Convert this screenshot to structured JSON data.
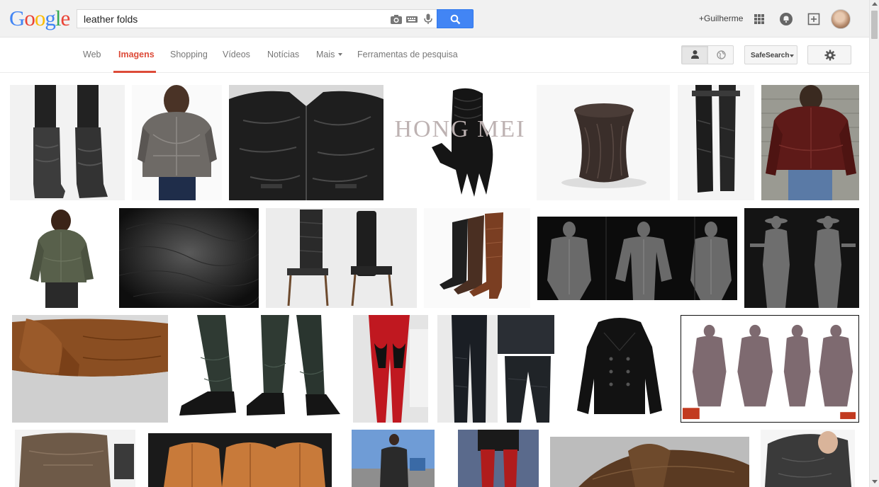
{
  "logo": {
    "letters": [
      "G",
      "o",
      "o",
      "g",
      "l",
      "e"
    ],
    "colors": [
      "#4285f4",
      "#ea4335",
      "#fbbc05",
      "#4285f4",
      "#34a853",
      "#ea4335"
    ]
  },
  "search": {
    "query": "leather folds"
  },
  "header": {
    "user_link": "+Guilherme"
  },
  "nav": {
    "tabs": [
      {
        "label": "Web",
        "active": false
      },
      {
        "label": "Imagens",
        "active": true
      },
      {
        "label": "Shopping",
        "active": false
      },
      {
        "label": "Vídeos",
        "active": false
      },
      {
        "label": "Notícias",
        "active": false
      },
      {
        "label": "Mais",
        "active": false
      },
      {
        "label": "Ferramentas de pesquisa",
        "active": false
      }
    ],
    "safesearch_label": "SafeSearch"
  },
  "thumb_watermarks": {
    "hong_mei": "HONG MEI"
  },
  "colors": {
    "accent": "#dd4b39",
    "search_button": "#4285f4"
  }
}
